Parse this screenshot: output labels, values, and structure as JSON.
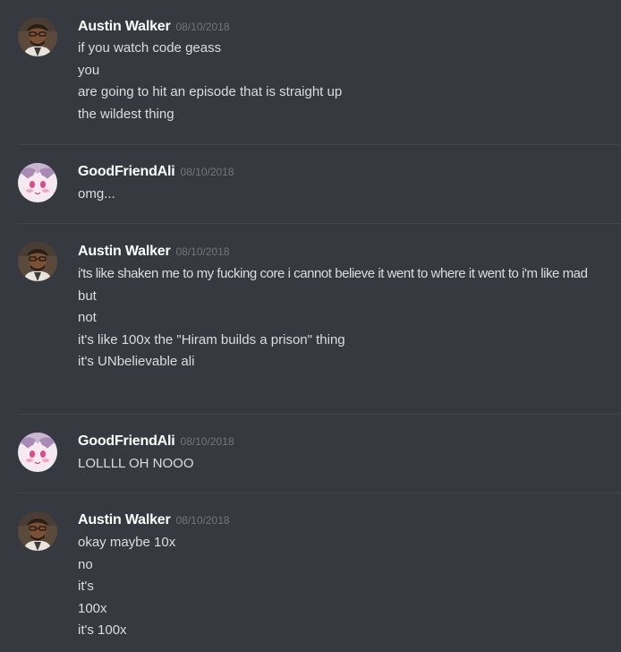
{
  "messages": [
    {
      "author": "Austin Walker",
      "avatar": "austin-avatar",
      "timestamp": "08/10/2018",
      "lines": [
        "if you watch code geass",
        "you",
        "are going to hit an episode that is straight up",
        "the wildest thing"
      ]
    },
    {
      "author": "GoodFriendAli",
      "avatar": "ali-avatar",
      "timestamp": "08/10/2018",
      "lines": [
        "omg..."
      ]
    },
    {
      "author": "Austin Walker",
      "avatar": "austin-avatar",
      "timestamp": "08/10/2018",
      "lines": [
        "i'ts like shaken me to my fucking core i cannot believe it went to where it went to i'm like mad",
        "but",
        "not",
        "it's like 100x the \"Hiram builds a prison\" thing",
        "it's UNbelievable ali"
      ]
    },
    {
      "author": "GoodFriendAli",
      "avatar": "ali-avatar",
      "timestamp": "08/10/2018",
      "lines": [
        "LOLLLL OH NOOO"
      ]
    },
    {
      "author": "Austin Walker",
      "avatar": "austin-avatar",
      "timestamp": "08/10/2018",
      "lines": [
        "okay maybe 10x",
        "no",
        "it's",
        "100x",
        "it's 100x"
      ]
    }
  ],
  "colors": {
    "background": "#36393f",
    "username": "#ffffff",
    "timestamp": "#72767d",
    "message_text": "#dcddde",
    "divider": "#40444b"
  }
}
